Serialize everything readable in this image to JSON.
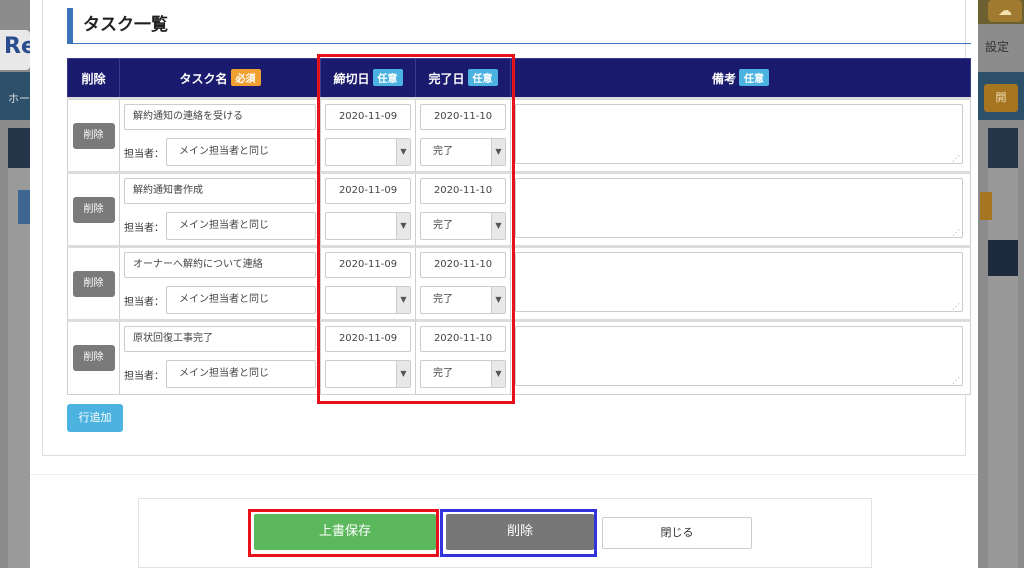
{
  "background": {
    "logo_text": "Re",
    "settings_label": "設定",
    "home_label": "ホー",
    "orange_button_label": "開"
  },
  "modal": {
    "section_title": "タスク一覧",
    "columns": {
      "delete": "削除",
      "task_name": "タスク名",
      "task_name_badge": "必須",
      "due_date": "締切日",
      "due_date_badge": "任意",
      "done_date": "完了日",
      "done_date_badge": "任意",
      "note": "備考",
      "note_badge": "任意"
    },
    "assignee_label": "担当者：",
    "row_delete_label": "削除",
    "tasks": [
      {
        "name": "解約通知の連絡を受ける",
        "assignee": "メイン担当者と同じ",
        "due": "2020-11-09",
        "done": "2020-11-10",
        "status": "完了"
      },
      {
        "name": "解約通知書作成",
        "assignee": "メイン担当者と同じ",
        "due": "2020-11-09",
        "done": "2020-11-10",
        "status": "完了"
      },
      {
        "name": "オーナーへ解約について連絡",
        "assignee": "メイン担当者と同じ",
        "due": "2020-11-09",
        "done": "2020-11-10",
        "status": "完了"
      },
      {
        "name": "原状回復工事完了",
        "assignee": "メイン担当者と同じ",
        "due": "2020-11-09",
        "done": "2020-11-10",
        "status": "完了"
      }
    ],
    "add_row_label": "行追加",
    "footer": {
      "save_label": "上書保存",
      "delete_label": "削除",
      "close_label": "閉じる"
    }
  },
  "colors": {
    "header_navy": "#1a1a6e",
    "required_badge": "#f0a030",
    "optional_badge": "#4cb3e0",
    "save_green": "#5cb85c",
    "highlight_red": "#e8101a",
    "highlight_blue": "#3333dd"
  }
}
